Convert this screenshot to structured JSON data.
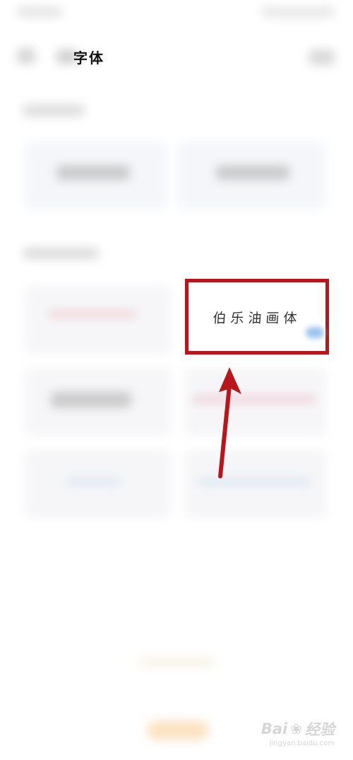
{
  "header": {
    "title_visible_part": "字体"
  },
  "highlight": {
    "font_name": "伯乐油画体"
  },
  "watermark": {
    "brand": "Bai",
    "brand_suffix": "经验",
    "url": "jingyan.baidu.com"
  },
  "colors": {
    "highlight_border": "#b8161b",
    "arrow": "#b8161b"
  },
  "icons": {
    "watermark_paw": "paw-icon",
    "arrow": "arrow-up-icon"
  }
}
